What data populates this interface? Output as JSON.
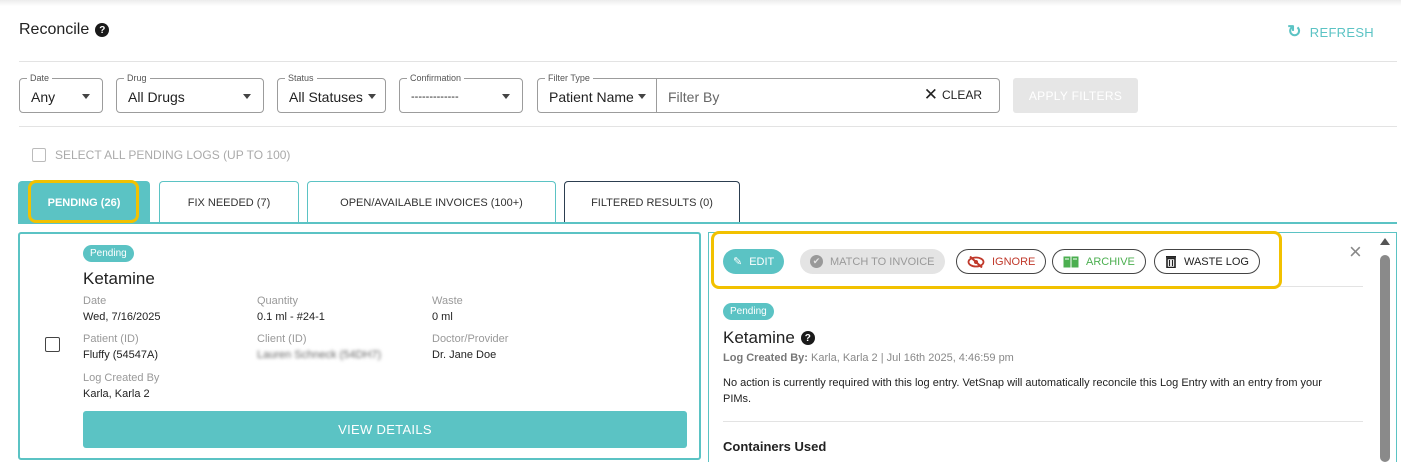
{
  "header": {
    "title": "Reconcile",
    "help_icon": "question-circle-icon",
    "refresh_label": "REFRESH",
    "refresh_icon": "refresh-icon"
  },
  "filters": {
    "date": {
      "label": "Date",
      "value": "Any"
    },
    "drug": {
      "label": "Drug",
      "value": "All Drugs"
    },
    "status": {
      "label": "Status",
      "value": "All Statuses"
    },
    "confirmation": {
      "label": "Confirmation",
      "value": "-------------"
    },
    "filter_type": {
      "label": "Filter Type",
      "value": "Patient Name"
    },
    "filter_by_placeholder": "Filter By",
    "clear_label": "CLEAR",
    "apply_label": "APPLY FILTERS"
  },
  "select_all_label": "SELECT ALL PENDING LOGS (UP TO 100)",
  "tabs": [
    {
      "label": "PENDING (26)"
    },
    {
      "label": "FIX NEEDED (7)"
    },
    {
      "label": "OPEN/AVAILABLE INVOICES (100+)"
    },
    {
      "label": "FILTERED RESULTS (0)"
    }
  ],
  "card": {
    "badge": "Pending",
    "drug": "Ketamine",
    "date_label": "Date",
    "date": "Wed, 7/16/2025",
    "quantity_label": "Quantity",
    "quantity": "0.1 ml - #24-1",
    "waste_label": "Waste",
    "waste": "0 ml",
    "patient_label": "Patient (ID)",
    "patient": "Fluffy (54547A)",
    "client_label": "Client (ID)",
    "client": "Lauren Schneck (54DH7)",
    "doctor_label": "Doctor/Provider",
    "doctor": "Dr. Jane Doe",
    "created_by_label": "Log Created By",
    "created_by": "Karla, Karla 2",
    "view_details_label": "VIEW DETAILS"
  },
  "detail": {
    "actions": {
      "edit": "EDIT",
      "match": "MATCH TO INVOICE",
      "ignore": "IGNORE",
      "archive": "ARCHIVE",
      "waste_log": "WASTE LOG"
    },
    "badge": "Pending",
    "drug": "Ketamine",
    "created_by_label": "Log Created By:",
    "created_by_value": "Karla, Karla 2  |  Jul 16th 2025, 4:46:59 pm",
    "message": "No action is currently required with this log entry. VetSnap will automatically reconcile this Log Entry with an entry from your PIMs.",
    "containers_heading": "Containers Used"
  },
  "colors": {
    "accent": "#5bc3c4",
    "highlight": "#f2c100",
    "ignore": "#c0392b",
    "archive": "#4caf50"
  }
}
